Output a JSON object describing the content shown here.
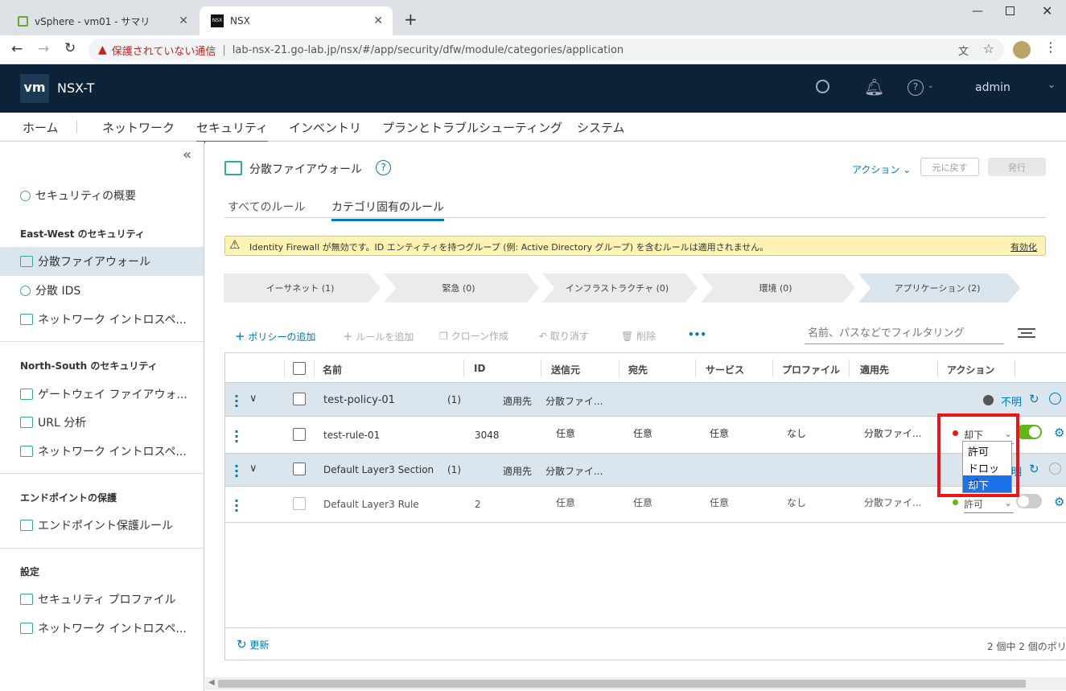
{
  "browser": {
    "tabs": [
      {
        "title": "vSphere - vm01 - サマリ"
      },
      {
        "title": "NSX"
      }
    ],
    "insecure_label": "保護されていない通信",
    "url": "lab-nsx-21.go-lab.jp/nsx/#/app/security/dfw/module/categories/application"
  },
  "header": {
    "logo": "vm",
    "product": "NSX-T",
    "user": "admin"
  },
  "main_nav": [
    "ホーム",
    "ネットワーク",
    "セキュリティ",
    "インベントリ",
    "プランとトラブルシューティング",
    "システム"
  ],
  "sidebar": {
    "overview": "セキュリティの概要",
    "ew_head": "East-West のセキュリティ",
    "ew_items": [
      "分散ファイアウォール",
      "分散 IDS",
      "ネットワーク イントロスペ..."
    ],
    "ns_head": "North-South のセキュリティ",
    "ns_items": [
      "ゲートウェイ ファイアウォ...",
      "URL 分析",
      "ネットワーク イントロスペ..."
    ],
    "ep_head": "エンドポイントの保護",
    "ep_items": [
      "エンドポイント保護ルール"
    ],
    "settings_head": "設定",
    "settings_items": [
      "セキュリティ プロファイル",
      "ネットワーク イントロスペ..."
    ]
  },
  "page": {
    "title": "分散ファイアウォール",
    "action_label": "アクション",
    "revert_label": "元に戻す",
    "publish_label": "発行",
    "tabs": [
      "すべてのルール",
      "カテゴリ固有のルール"
    ],
    "warning": "Identity Firewall が無効です。ID エンティティを持つグループ (例: Active Directory グループ) を含むルールは適用されません。",
    "warning_link": "有効化",
    "categories": [
      "イーサネット (1)",
      "緊急 (0)",
      "インフラストラクチャ (0)",
      "環境 (0)",
      "アプリケーション (2)"
    ],
    "toolbar": {
      "add_policy": "ポリシーの追加",
      "add_rule": "ルールを追加",
      "clone": "クローン作成",
      "undo": "取り消す",
      "delete": "削除",
      "more": "•••",
      "filter_placeholder": "名前、パスなどでフィルタリング"
    },
    "columns": [
      "名前",
      "ID",
      "送信元",
      "宛先",
      "サービス",
      "プロファイル",
      "適用先",
      "アクション"
    ],
    "policies": [
      {
        "name": "test-policy-01",
        "count": "(1)",
        "applied_label": "適用先",
        "applied": "分散ファイ...",
        "status": "不明"
      },
      {
        "name": "Default Layer3 Section",
        "count": "(1)",
        "applied_label": "適用先",
        "applied": "分散ファイ...",
        "status": "不明"
      }
    ],
    "rules": [
      {
        "name": "test-rule-01",
        "id": "3048",
        "src": "任意",
        "dst": "任意",
        "svc": "任意",
        "profile": "なし",
        "applied": "分散ファイ...",
        "action": "却下",
        "enabled": true
      },
      {
        "name": "Default Layer3 Rule",
        "id": "2",
        "src": "任意",
        "dst": "任意",
        "svc": "任意",
        "profile": "なし",
        "applied": "分散ファイ...",
        "action": "許可",
        "enabled": false
      }
    ],
    "dropdown_options": [
      "許可",
      "ドロップ",
      "却下"
    ],
    "dropdown_selected": "却下",
    "refresh": "更新",
    "footer_count": "2 個中 2 個のポリ"
  },
  "colors": {
    "header_bg": "#0c2238",
    "accent": "#0079b8",
    "highlight": "#e8151b",
    "toggle_on": "#5eb715",
    "dropdown_selected": "#1a73e8"
  }
}
